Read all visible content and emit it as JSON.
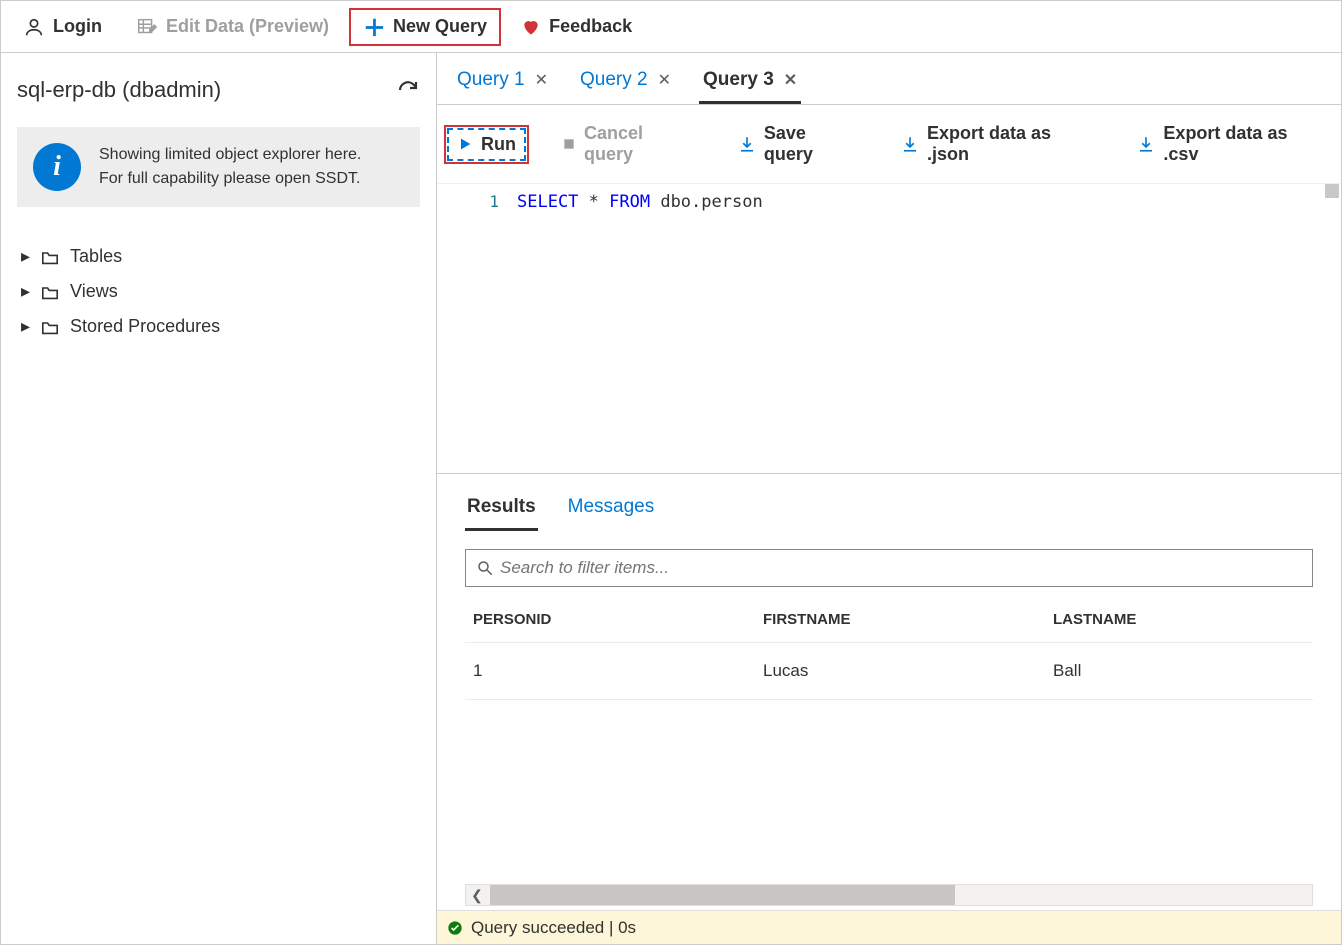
{
  "toolbar": {
    "login": "Login",
    "editData": "Edit Data (Preview)",
    "newQuery": "New Query",
    "feedback": "Feedback"
  },
  "sidebar": {
    "dbTitle": "sql-erp-db (dbadmin)",
    "infoLine1": "Showing limited object explorer here.",
    "infoLine2": "For full capability please open SSDT.",
    "tree": {
      "tables": "Tables",
      "views": "Views",
      "sprocs": "Stored Procedures"
    }
  },
  "queryTabs": {
    "tab1": "Query 1",
    "tab2": "Query 2",
    "tab3": "Query 3"
  },
  "queryToolbar": {
    "run": "Run",
    "cancel": "Cancel query",
    "save": "Save query",
    "exportJson": "Export data as .json",
    "exportCsv": "Export data as .csv"
  },
  "editor": {
    "lineNumber": "1",
    "kw1": "SELECT",
    "star": " * ",
    "kw2": "FROM",
    "rest": " dbo.person"
  },
  "resultsTabs": {
    "results": "Results",
    "messages": "Messages"
  },
  "search": {
    "placeholder": "Search to filter items..."
  },
  "grid": {
    "headers": {
      "c1": "PERSONID",
      "c2": "FIRSTNAME",
      "c3": "LASTNAME"
    },
    "row1": {
      "c1": "1",
      "c2": "Lucas",
      "c3": "Ball"
    }
  },
  "status": {
    "text": "Query succeeded | 0s"
  }
}
